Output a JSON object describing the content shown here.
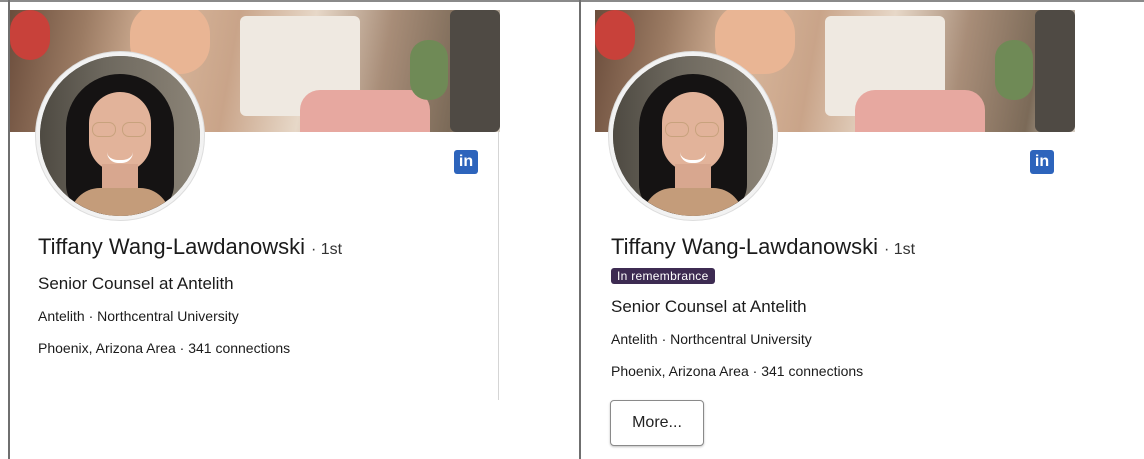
{
  "colors": {
    "linkedin_blue": "#2d64bc",
    "remembrance_bg": "#3d2b52"
  },
  "left_card": {
    "linkedin_icon_text": "in",
    "name": "Tiffany Wang-Lawdanowski",
    "degree": "· 1st",
    "headline": "Senior Counsel at Antelith",
    "org_line": "Antelith · Northcentral University",
    "location_line": "Phoenix, Arizona Area · 341 connections"
  },
  "right_card": {
    "linkedin_icon_text": "in",
    "name": "Tiffany Wang-Lawdanowski",
    "degree": "· 1st",
    "badge": "In remembrance",
    "headline": "Senior Counsel at Antelith",
    "org_line": "Antelith · Northcentral University",
    "location_line": "Phoenix, Arizona Area · 341 connections",
    "more_button": "More..."
  }
}
